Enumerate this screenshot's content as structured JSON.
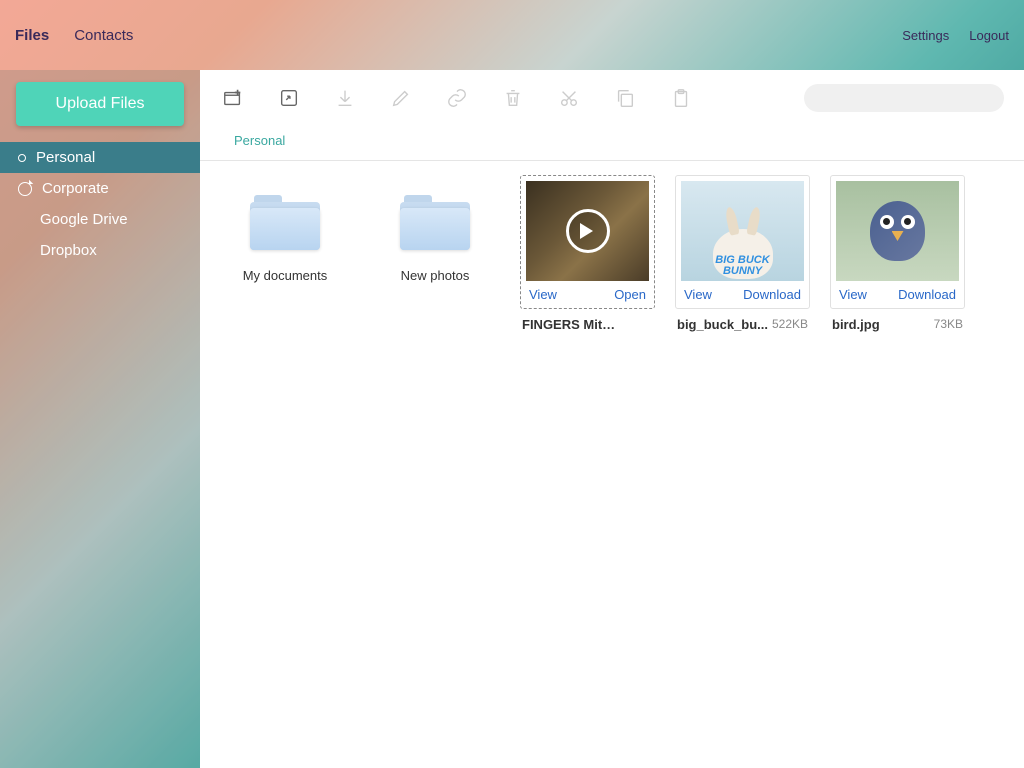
{
  "header": {
    "nav": [
      {
        "label": "Files",
        "active": true
      },
      {
        "label": "Contacts",
        "active": false
      }
    ],
    "links": [
      {
        "label": "Settings"
      },
      {
        "label": "Logout"
      }
    ]
  },
  "sidebar": {
    "uploadLabel": "Upload Files",
    "items": [
      {
        "label": "Personal",
        "type": "root",
        "selected": true
      },
      {
        "label": "Corporate",
        "type": "root",
        "selected": false
      },
      {
        "label": "Google Drive",
        "type": "child"
      },
      {
        "label": "Dropbox",
        "type": "child"
      }
    ]
  },
  "breadcrumb": {
    "current": "Personal"
  },
  "folders": [
    {
      "name": "My documents"
    },
    {
      "name": "New photos"
    }
  ],
  "files": [
    {
      "name": "FINGERS Mitchell C...",
      "size": "",
      "view": "View",
      "action": "Open",
      "type": "video",
      "selected": true
    },
    {
      "name": "big_buck_bu...",
      "size": "522KB",
      "view": "View",
      "action": "Download",
      "type": "bunny",
      "selected": false
    },
    {
      "name": "bird.jpg",
      "size": "73KB",
      "view": "View",
      "action": "Download",
      "type": "bird",
      "selected": false
    }
  ],
  "bunnyText": {
    "line1": "BIG BUCK",
    "line2": "BUNNY"
  }
}
